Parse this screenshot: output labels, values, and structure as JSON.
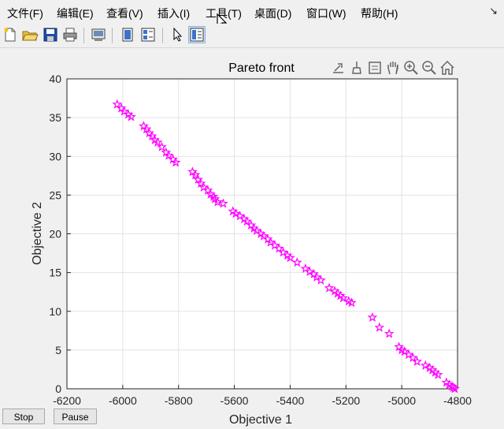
{
  "menu": {
    "items": [
      "文件(F)",
      "编辑(E)",
      "查看(V)",
      "插入(I)",
      "工具(T)",
      "桌面(D)",
      "窗口(W)",
      "帮助(H)"
    ],
    "overflow_icon": "dock-arrow-icon"
  },
  "toolbar": {
    "icons": [
      "new-figure-icon",
      "open-file-icon",
      "save-icon",
      "print-icon",
      "print-preview-icon",
      "hide-plot-tools-icon",
      "show-plot-tools-icon",
      "edit-plot-cursor-icon",
      "plot-tools-dock-icon"
    ]
  },
  "axes_toolbar": {
    "icons": [
      "export-icon",
      "brush-icon",
      "data-tips-icon",
      "pan-hand-icon",
      "zoom-in-icon",
      "zoom-out-icon",
      "home-icon"
    ]
  },
  "chart_data": {
    "type": "scatter",
    "title": "Pareto front",
    "xlabel": "Objective 1",
    "ylabel": "Objective 2",
    "xlim": [
      -6200,
      -4800
    ],
    "ylim": [
      0,
      40
    ],
    "xticks": [
      -6200,
      -6000,
      -5800,
      -5600,
      -5400,
      -5200,
      -5000,
      -4800
    ],
    "yticks": [
      0,
      5,
      10,
      15,
      20,
      25,
      30,
      35,
      40
    ],
    "xtick_labels": [
      "-6200",
      "-6000",
      "-5800",
      "-5600",
      "-5400",
      "-5200",
      "-5000",
      "-4800"
    ],
    "ytick_labels": [
      "0",
      "5",
      "10",
      "15",
      "20",
      "25",
      "30",
      "35",
      "40"
    ],
    "grid": true,
    "marker": "pentagram",
    "color": "#ff00ff",
    "x": [
      -6020,
      -6005,
      -5995,
      -5980,
      -5970,
      -5925,
      -5915,
      -5905,
      -5895,
      -5885,
      -5875,
      -5860,
      -5845,
      -5835,
      -5820,
      -5810,
      -5750,
      -5740,
      -5730,
      -5720,
      -5710,
      -5695,
      -5685,
      -5675,
      -5670,
      -5660,
      -5640,
      -5605,
      -5595,
      -5580,
      -5565,
      -5555,
      -5540,
      -5530,
      -5520,
      -5505,
      -5495,
      -5480,
      -5470,
      -5455,
      -5440,
      -5425,
      -5410,
      -5400,
      -5375,
      -5345,
      -5330,
      -5315,
      -5305,
      -5290,
      -5260,
      -5240,
      -5230,
      -5220,
      -5210,
      -5190,
      -5180,
      -5105,
      -5080,
      -5045,
      -5010,
      -5000,
      -4990,
      -4975,
      -4960,
      -4945,
      -4915,
      -4900,
      -4890,
      -4880,
      -4870,
      -4840,
      -4830,
      -4820,
      -4815,
      -4810
    ],
    "y": [
      36.7,
      36.2,
      35.8,
      35.4,
      35.1,
      33.9,
      33.5,
      33.0,
      32.6,
      32.1,
      31.8,
      31.2,
      30.5,
      30.1,
      29.6,
      29.2,
      28.0,
      27.6,
      27.0,
      26.5,
      26.0,
      25.6,
      25.1,
      24.8,
      24.5,
      24.1,
      23.9,
      22.9,
      22.6,
      22.3,
      21.9,
      21.6,
      21.1,
      20.7,
      20.4,
      20.0,
      19.7,
      19.3,
      18.9,
      18.5,
      18.1,
      17.6,
      17.2,
      16.9,
      16.3,
      15.5,
      15.1,
      14.8,
      14.4,
      14.0,
      13.0,
      12.6,
      12.3,
      12.0,
      11.7,
      11.3,
      11.1,
      9.2,
      7.9,
      7.1,
      5.4,
      5.0,
      4.8,
      4.4,
      4.0,
      3.5,
      3.0,
      2.7,
      2.4,
      2.1,
      1.8,
      0.8,
      0.5,
      0.3,
      0.15,
      0.0
    ]
  },
  "controls": {
    "stop_label": "Stop",
    "pause_label": "Pause"
  }
}
